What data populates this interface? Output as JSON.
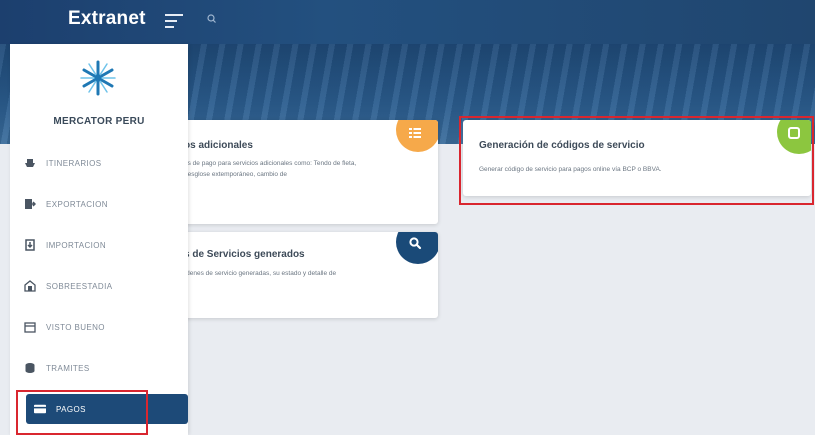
{
  "header": {
    "brand": "Extranet"
  },
  "sidebar": {
    "company": "MERCATOR PERU",
    "items": [
      {
        "label": "ITINERARIOS"
      },
      {
        "label": "EXPORTACION"
      },
      {
        "label": "IMPORTACION"
      },
      {
        "label": "SOBREESTADIA"
      },
      {
        "label": "VISTO BUENO"
      },
      {
        "label": "TRAMITES"
      },
      {
        "label": "PAGOS"
      }
    ]
  },
  "cards": {
    "servicios": {
      "title": "os adicionales",
      "desc": "es de pago para servicios adicionales como: Tendo de fleta, desglose extemporáneo, cambio de"
    },
    "generados": {
      "title": "s de Servicios generados",
      "desc": "rdenes de servicio generadas, su estado y detalle de"
    },
    "codigos": {
      "title": "Generación de códigos de servicio",
      "desc": "Generar código de servicio para pagos online vía BCP o BBVA."
    }
  },
  "colors": {
    "header": "#1c3f6e",
    "sidebar_active": "#1d4a78",
    "orange": "#f6a94a",
    "navy": "#1a4a78",
    "green": "#8cc63f",
    "highlight": "#d9262f"
  }
}
